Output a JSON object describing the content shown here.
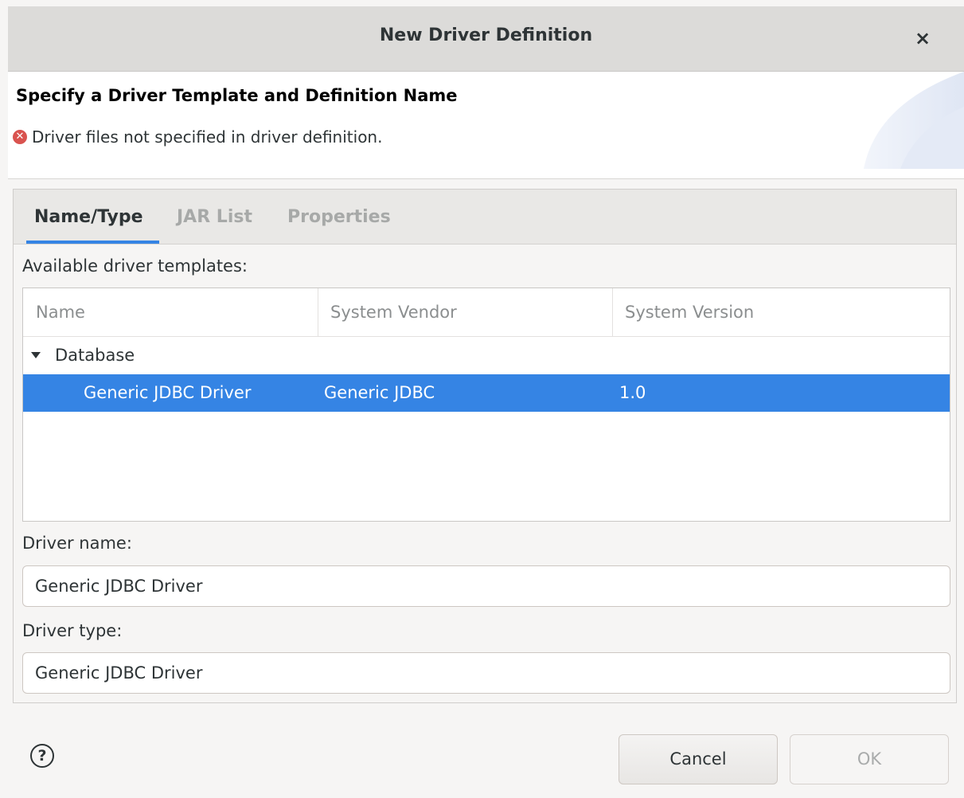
{
  "window": {
    "title": "New Driver Definition",
    "close_glyph": "×"
  },
  "header": {
    "title": "Specify a Driver Template and Definition Name",
    "message": "Driver files not specified in driver definition.",
    "message_icon": "error-icon"
  },
  "tabs": [
    {
      "label": "Name/Type",
      "active": true
    },
    {
      "label": "JAR List",
      "active": false
    },
    {
      "label": "Properties",
      "active": false
    }
  ],
  "templates": {
    "label": "Available driver templates:",
    "columns": [
      "Name",
      "System Vendor",
      "System Version"
    ],
    "group": "Database",
    "rows": [
      {
        "name": "Generic JDBC Driver",
        "vendor": "Generic JDBC",
        "version": "1.0",
        "selected": true
      }
    ]
  },
  "driver_name": {
    "label": "Driver name:",
    "value": "Generic JDBC Driver"
  },
  "driver_type": {
    "label": "Driver type:",
    "value": "Generic JDBC Driver"
  },
  "footer": {
    "help_glyph": "?",
    "cancel_label": "Cancel",
    "ok_label": "OK",
    "ok_enabled": false
  },
  "colors": {
    "accent": "#3584e4",
    "error": "#d9534f"
  }
}
